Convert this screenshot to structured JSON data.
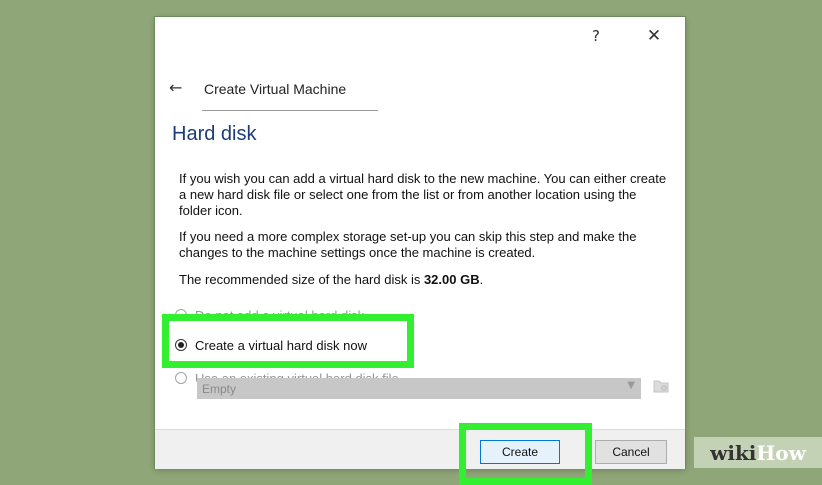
{
  "window": {
    "help_label": "?",
    "close_label": "✕"
  },
  "nav": {
    "back_label": "←",
    "title": "Create Virtual Machine"
  },
  "section": {
    "title": "Hard disk"
  },
  "description": {
    "p1": "If you wish you can add a virtual hard disk to the new machine. You can either create a new hard disk file or select one from the list or from another location using the folder icon.",
    "p2": "If you need a more complex storage set-up you can skip this step and make the changes to the machine settings once the machine is created.",
    "p3_prefix": "The recommended size of the hard disk is ",
    "p3_size": "32.00 GB",
    "p3_suffix": "."
  },
  "options": [
    {
      "label": "Do not add a virtual hard disk",
      "selected": false
    },
    {
      "label": "Create a virtual hard disk now",
      "selected": true
    },
    {
      "label": "Use an existing virtual hard disk file",
      "selected": false
    }
  ],
  "disk_select": {
    "value": "Empty",
    "arrow": "▼"
  },
  "footer": {
    "create_label": "Create",
    "cancel_label": "Cancel"
  },
  "watermark": {
    "wiki": "wiki",
    "how": "How"
  },
  "colors": {
    "highlight": "#32ef32",
    "background": "#8fa678",
    "section_title": "#1d3c78"
  }
}
